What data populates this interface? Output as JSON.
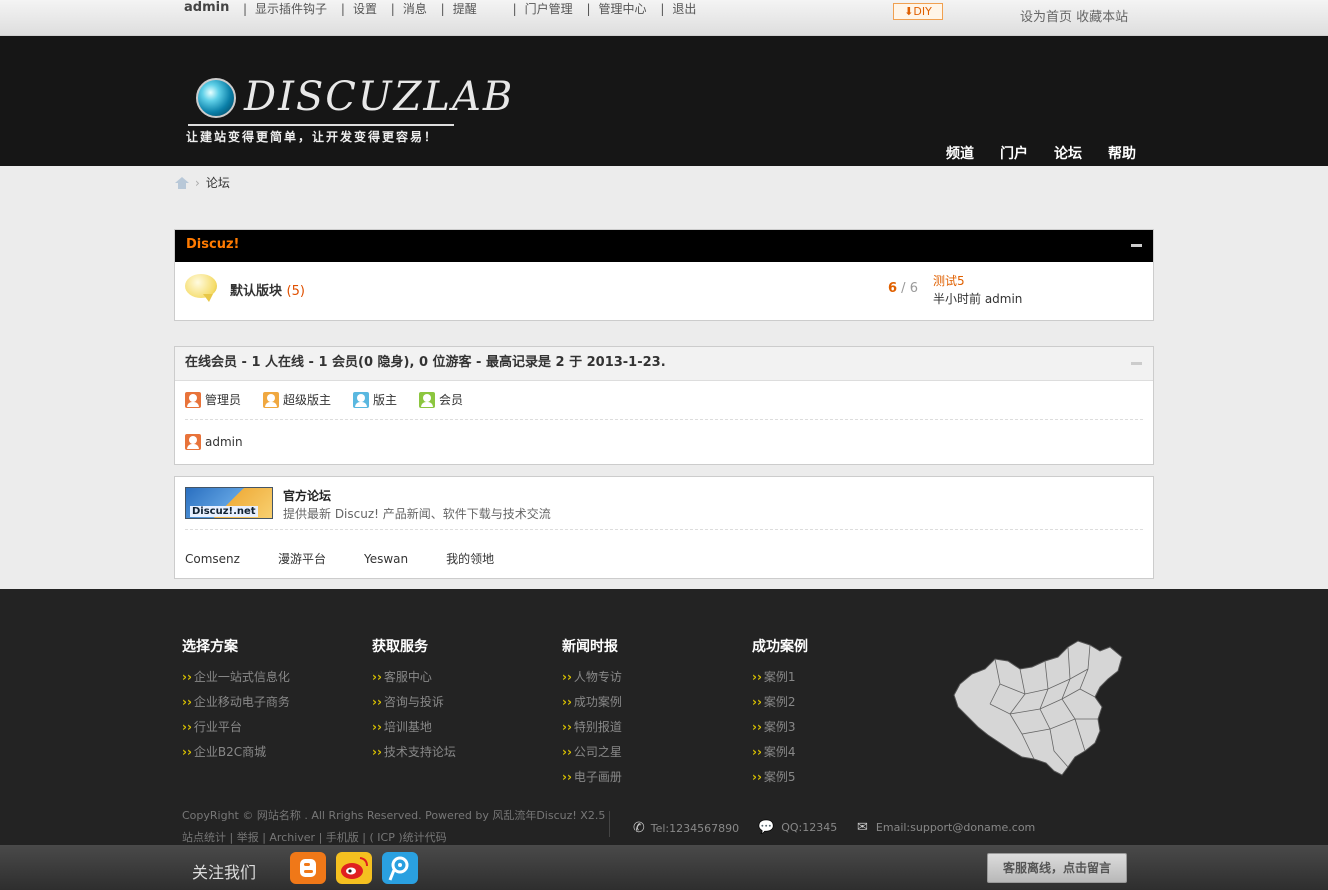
{
  "topbar": {
    "user": "admin",
    "nav": [
      "显示插件钩子",
      "设置",
      "消息",
      "提醒",
      "门户管理",
      "管理中心",
      "退出"
    ],
    "diy": "DIY",
    "right_links": "设为首页 收藏本站"
  },
  "header": {
    "logo_text": "DISCUZLAB",
    "slogan": "让建站变得更简单，让开发变得更容易！",
    "nav": [
      "频道",
      "门户",
      "论坛",
      "帮助"
    ]
  },
  "breadcrumb": {
    "current": "论坛"
  },
  "forum_group": {
    "title": "Discuz!",
    "forum": {
      "name": "默认版块",
      "count": "(5)",
      "threads": "6",
      "posts": "6",
      "last_title": "测试5",
      "last_meta": "半小时前 admin"
    }
  },
  "online": {
    "header": "在线会员 - 1 人在线 - 1 会员(0 隐身), 0 位游客 - 最高记录是 2 于 2013-1-23.",
    "legend": [
      {
        "label": "管理员",
        "color": "#e8733a"
      },
      {
        "label": "超级版主",
        "color": "#f0a840"
      },
      {
        "label": "版主",
        "color": "#5ab8e0"
      },
      {
        "label": "会员",
        "color": "#8cc63f"
      }
    ],
    "users": [
      "admin"
    ]
  },
  "friendlinks": {
    "logo_text": "Discuz!.net",
    "title": "官方论坛",
    "desc": "提供最新 Discuz! 产品新闻、软件下载与技术交流",
    "links": [
      "Comsenz",
      "漫游平台",
      "Yeswan",
      "我的领地"
    ]
  },
  "footer": {
    "columns": [
      {
        "title": "选择方案",
        "items": [
          "企业一站式信息化",
          "企业移动电子商务",
          "行业平台",
          "企业B2C商城"
        ]
      },
      {
        "title": "获取服务",
        "items": [
          "客服中心",
          "咨询与投诉",
          "培训基地",
          "技术支持论坛"
        ]
      },
      {
        "title": "新闻时报",
        "items": [
          "人物专访",
          "成功案例",
          "特别报道",
          "公司之星",
          "电子画册"
        ]
      },
      {
        "title": "成功案例",
        "items": [
          "案例1",
          "案例2",
          "案例3",
          "案例4",
          "案例5"
        ]
      }
    ],
    "copyright": "CopyRight © 网站名称 . All Rrighs Reserved. Powered by 风乱流年Discuz! X2.5",
    "sublinks": "站点统计 | 举报 | Archiver | 手机版 | ( ICP )统计代码",
    "tel": "Tel:1234567890",
    "qq": "QQ:12345",
    "email": "Email:support@doname.com"
  },
  "bottombar": {
    "follow": "关注我们",
    "kefu": "客服离线，点击留言"
  }
}
